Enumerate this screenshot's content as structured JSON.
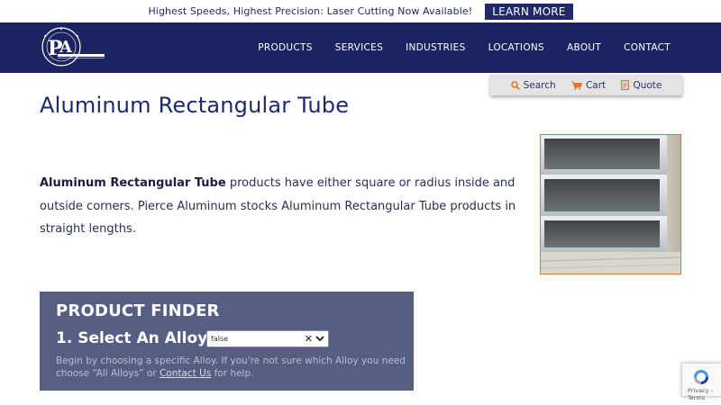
{
  "topbar": {
    "message": "Highest Speeds, Highest Precision: Laser Cutting Now Available!",
    "cta_label": "LEARN MORE"
  },
  "header": {
    "logo_text": "PA",
    "logo_icon": "pierce-aluminum-logo",
    "nav": [
      "PRODUCTS",
      "SERVICES",
      "INDUSTRIES",
      "LOCATIONS",
      "ABOUT",
      "CONTACT"
    ]
  },
  "utility": {
    "search": "Search",
    "cart": "Cart",
    "quote": "Quote",
    "icons": [
      "search-icon",
      "cart-icon",
      "quote-icon"
    ]
  },
  "page": {
    "title": "Aluminum Rectangular Tube",
    "intro_bold": "Aluminum Rectangular Tube",
    "intro_rest": " products have either square or radius inside and outside corners. Pierce Aluminum stocks Aluminum Rectangular Tube products in straight lengths."
  },
  "finder": {
    "title": "PRODUCT FINDER",
    "step": "1. Select An Alloy",
    "alloy_value": "false",
    "help_before": "Begin by choosing a specific Alloy. If you're not sure which Alloy you need choose “All Alloys” or ",
    "help_link": "Contact Us",
    "help_after": " for help."
  },
  "recaptcha": {
    "text": "Privacy - Terms"
  },
  "colors": {
    "navy": "#1b2461",
    "accent_orange": "#e0762b",
    "finder_bg": "#565e82"
  }
}
